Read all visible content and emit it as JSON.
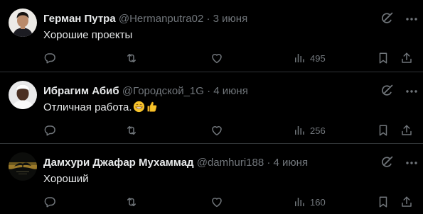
{
  "replies": [
    {
      "name": "Герман Путра",
      "handle": "@Hermanputra02",
      "separator": "·",
      "date": "3 июня",
      "text": "Хорошие проекты",
      "views": "495",
      "avatar_icon": "person-avatar-dark-hair"
    },
    {
      "name": "Ибрагим Абиб",
      "handle": "@Городской_1G",
      "separator": "·",
      "date": "4 июня",
      "text": "Отличная работа.",
      "emojis": [
        "grinning-face-emoji",
        "thumbs-up-emoji"
      ],
      "views": "256",
      "avatar_icon": "person-avatar-white-cap"
    },
    {
      "name": "Дамхури Джафар Мухаммад",
      "handle": "@damhuri188",
      "separator": "·",
      "date": "4 июня",
      "text": "Хороший",
      "views": "160",
      "avatar_icon": "sunset-tree-avatar"
    }
  ],
  "colors": {
    "background": "#000000",
    "text_primary": "#e7e9ea",
    "text_secondary": "#71767b",
    "divider": "#2f3336"
  }
}
